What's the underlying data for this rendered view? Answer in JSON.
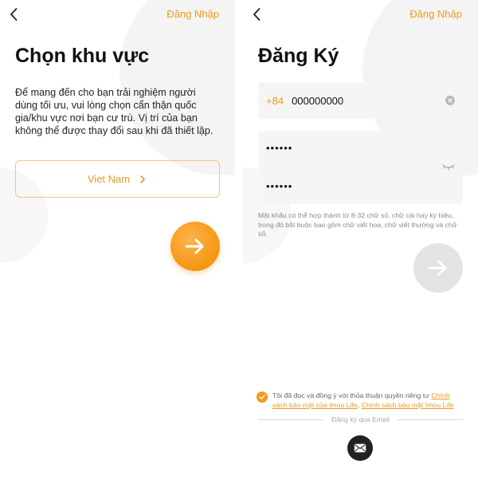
{
  "left": {
    "top_link": "Đăng Nhập",
    "title": "Chọn khu vực",
    "description": "Để mang đến cho bạn trải nghiệm người dùng tối ưu, vui lòng chọn cẩn thận quốc gia/khu vực nơi bạn cư trú. Vị trí của bạn không thể được thay đổi sau khi đã thiết lập.",
    "region_value": "Viet Nam",
    "icons": {
      "back": "chevron-left-icon",
      "region": "chevron-right-icon",
      "next": "arrow-right-icon"
    }
  },
  "right": {
    "top_link": "Đăng Nhập",
    "title": "Đăng Ký",
    "phone_prefix": "+84",
    "phone_value": "000000000",
    "password_mask": "••••••",
    "confirm_password_mask": "••••••",
    "password_hint": "Mật khẩu có thể hợp thành từ 8-32 chữ số, chữ cái hay ký hiệu, trong đó bắt buộc bao gồm chữ viết hoa, chữ viết thường và chữ số.",
    "consent_prefix": "Tôi đã đọc và đồng ý với thỏa thuận quyền riêng tư ",
    "consent_link1": "Chính sách bảo mật của Imou Life",
    "consent_sep": ", ",
    "consent_link2": "Chính sách bảo mật Imou Life",
    "email_signup_label": "Đăng ký qua Email",
    "icons": {
      "back": "chevron-left-icon",
      "clear": "clear-circle-icon",
      "eye": "eye-closed-icon",
      "next": "arrow-right-icon",
      "check": "check-circle-icon",
      "mail": "mail-icon"
    }
  },
  "colors": {
    "accent": "#F29A1C",
    "disabled": "#E3E3E3",
    "field_bg": "#F5F5F5"
  }
}
